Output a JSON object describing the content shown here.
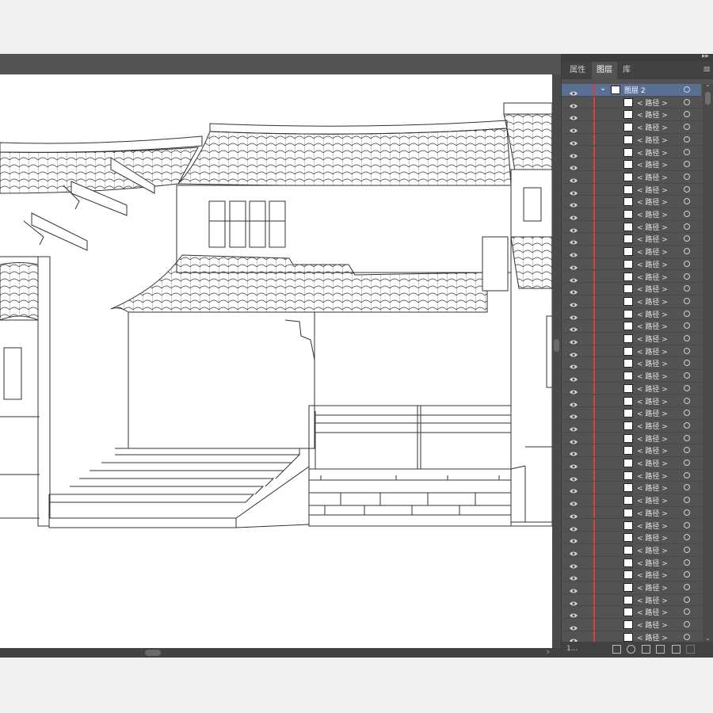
{
  "panel": {
    "tabs": [
      {
        "label": "属性",
        "active": false
      },
      {
        "label": "图层",
        "active": true
      },
      {
        "label": "库",
        "active": false
      }
    ],
    "layer": {
      "name": "图层 2",
      "expanded": true
    },
    "path_label": "< 路径 >",
    "visible_path_rows": 44,
    "layer_count": "1...",
    "accent_color": "#e23d3d",
    "selection_color": "#5a6f94"
  },
  "icons": [
    "eye-icon",
    "chevron-down-icon",
    "target-circle-icon",
    "panel-menu-icon",
    "collapse-icon",
    "export-icon",
    "search-icon",
    "clip-icon",
    "new-sublayer-icon",
    "new-layer-icon",
    "delete-icon"
  ]
}
